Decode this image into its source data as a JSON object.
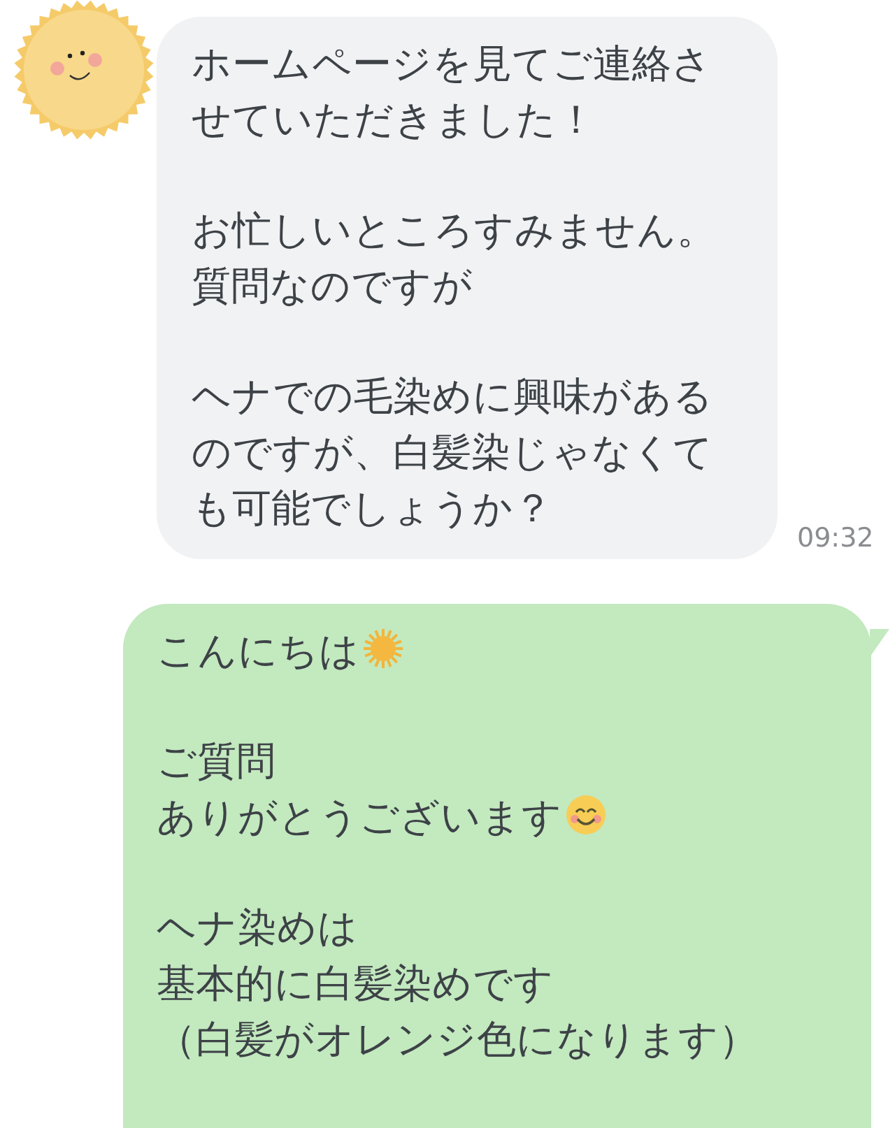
{
  "messages": [
    {
      "kind": "incoming",
      "time": "09:32",
      "paragraphs": [
        [
          {
            "kind": "plain",
            "text": "ホームページを見てご連絡させていただきました！"
          }
        ],
        [
          {
            "kind": "plain",
            "text": "お忙しいところすみません。"
          },
          {
            "kind": "plain",
            "text": "質問なのですが"
          }
        ],
        [
          {
            "kind": "plain",
            "text": "ヘナでの毛染めに興味があるのですが、白髪染じゃなくても可能でしょうか？"
          }
        ]
      ]
    },
    {
      "kind": "outgoing",
      "paragraphs": [
        [
          {
            "kind": "sun",
            "text": "こんにちは"
          }
        ],
        [
          {
            "kind": "plain",
            "text": "ご質問"
          },
          {
            "kind": "smile",
            "text": "ありがとうございます"
          }
        ],
        [
          {
            "kind": "plain",
            "text": "ヘナ染めは"
          },
          {
            "kind": "plain",
            "text": "基本的に白髪染めです"
          },
          {
            "kind": "plain",
            "text": "（白髪がオレンジ色になります）"
          }
        ]
      ]
    }
  ]
}
